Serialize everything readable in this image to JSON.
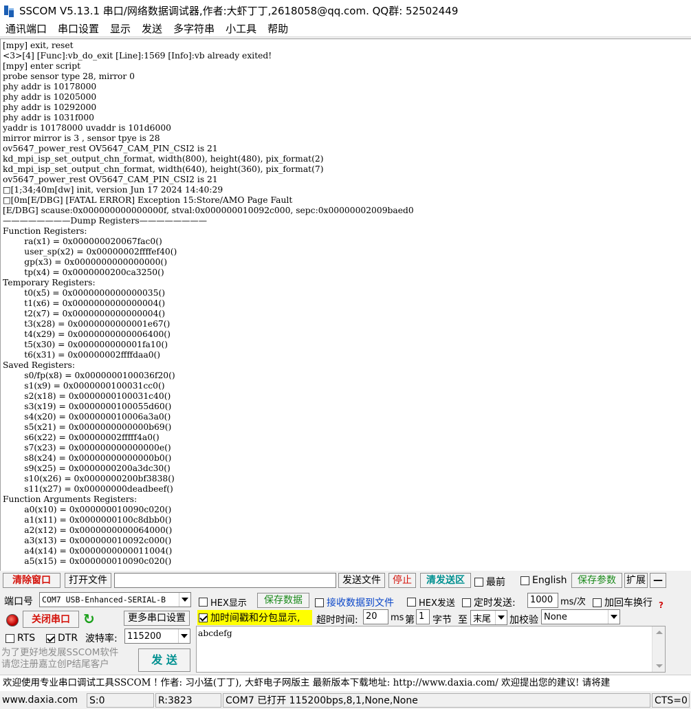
{
  "window": {
    "title": "SSCOM V5.13.1 串口/网络数据调试器,作者:大虾丁丁,2618058@qq.com. QQ群: 52502449"
  },
  "menu": [
    "通讯端口",
    "串口设置",
    "显示",
    "发送",
    "多字符串",
    "小工具",
    "帮助"
  ],
  "terminal": {
    "lines": [
      "[mpy] exit, reset",
      "<3>[4] [Func]:vb_do_exit [Line]:1569 [Info]:vb already exited!",
      "[mpy] enter script",
      "probe sensor type 28, mirror 0",
      "phy addr is 10178000",
      "phy addr is 10205000",
      "phy addr is 10292000",
      "phy addr is 1031f000",
      "yaddr is 10178000 uvaddr is 101d6000",
      "mirror mirror is 3 , sensor tpye is 28",
      "ov5647_power_rest OV5647_CAM_PIN_CSI2 is 21",
      "kd_mpi_isp_set_output_chn_format, width(800), height(480), pix_format(2)",
      "kd_mpi_isp_set_output_chn_format, width(640), height(360), pix_format(7)",
      "ov5647_power_rest OV5647_CAM_PIN_CSI2 is 21",
      "□[1;34;40m[dw] init, version Jun 17 2024 14:40:29",
      "□[0m[E/DBG] [FATAL ERROR] Exception 15:Store/AMO Page Fault",
      "[E/DBG] scause:0x000000000000000f, stval:0x000000010092c000, sepc:0x00000002009baed0",
      "————————Dump Registers————————",
      "Function Registers:",
      "        ra(x1) = 0x000000020067fac0()",
      "        user_sp(x2) = 0x00000002ffffef40()",
      "        gp(x3) = 0x0000000000000000()",
      "        tp(x4) = 0x0000000200ca3250()",
      "Temporary Registers:",
      "        t0(x5) = 0x0000000000000035()",
      "        t1(x6) = 0x0000000000000004()",
      "        t2(x7) = 0x0000000000000004()",
      "        t3(x28) = 0x0000000000001e67()",
      "        t4(x29) = 0x0000000000006400()",
      "        t5(x30) = 0x000000000001fa10()",
      "        t6(x31) = 0x00000002ffffdaa0()",
      "Saved Registers:",
      "        s0/fp(x8) = 0x0000000100036f20()",
      "        s1(x9) = 0x0000000100031cc0()",
      "        s2(x18) = 0x0000000100031c40()",
      "        s3(x19) = 0x0000000100055d60()",
      "        s4(x20) = 0x000000010006a3a0()",
      "        s5(x21) = 0x0000000000000b69()",
      "        s6(x22) = 0x00000002fffff4a0()",
      "        s7(x23) = 0x000000000000000e()",
      "        s8(x24) = 0x00000000000000b0()",
      "        s9(x25) = 0x0000000200a3dc30()",
      "        s10(x26) = 0x0000000200bf3838()",
      "        s11(x27) = 0x00000000deadbeef()",
      "Function Arguments Registers:",
      "        a0(x10) = 0x000000010090c020()",
      "        a1(x11) = 0x0000000100c8dbb0()",
      "        a2(x12) = 0x0000000000064000()",
      "        a3(x13) = 0x000000010092c000()",
      "        a4(x14) = 0x0000000000011004()",
      "        a5(x15) = 0x000000010090c020()"
    ]
  },
  "toolbar1": {
    "clear_window": "清除窗口",
    "open_file": "打开文件",
    "send_file": "发送文件",
    "stop": "停止",
    "clear_send_area": "清发送区",
    "topmost": "最前",
    "english": "English",
    "save_params": "保存参数",
    "expand": "扩展",
    "collapse": "—"
  },
  "port": {
    "port_label": "端口号",
    "port_value": "COM7 USB-Enhanced-SERIAL-B",
    "close_port": "关闭串口",
    "more_settings": "更多串口设置",
    "rts": "RTS",
    "dtr": "DTR",
    "baud_label": "波特率:",
    "baud_value": "115200"
  },
  "options": {
    "hex_display": "HEX显示",
    "save_data": "保存数据",
    "recv_to_file": "接收数据到文件",
    "hex_send": "HEX发送",
    "timed_send": "定时发送:",
    "interval": "1000",
    "interval_unit": "ms/次",
    "add_crlf": "加回车换行",
    "timestamp": "加时间戳和分包显示,",
    "timeout_label": "超时时间:",
    "timeout_value": "20",
    "timeout_unit": "ms",
    "byte_no_label": "第",
    "byte_no": "1",
    "byte_label": "字节",
    "to_label": "至",
    "to_value": "末尾",
    "checksum_label": "加校验",
    "checksum_value": "None"
  },
  "promo": {
    "line1": "为了更好地发展SSCOM软件",
    "line2": "请您注册嘉立创P结尾客户"
  },
  "send": {
    "button": "发 送",
    "text": "abcdefg"
  },
  "marquee": "欢迎使用专业串口调试工具SSCOM !  作者: 习小猛(丁丁), 大虾电子网版主  最新版本下载地址: http://www.daxia.com/  欢迎提出您的建议! 请将建",
  "status": {
    "site": "www.daxia.com",
    "sent": "S:0",
    "received": "R:3823",
    "port_state": "COM7 已打开  115200bps,8,1,None,None",
    "cts": "CTS=0"
  },
  "colors": {
    "accent_red": "#d4140c",
    "teal": "#009090",
    "green": "#1b8a1b",
    "highlight_yellow": "#ffff00"
  }
}
